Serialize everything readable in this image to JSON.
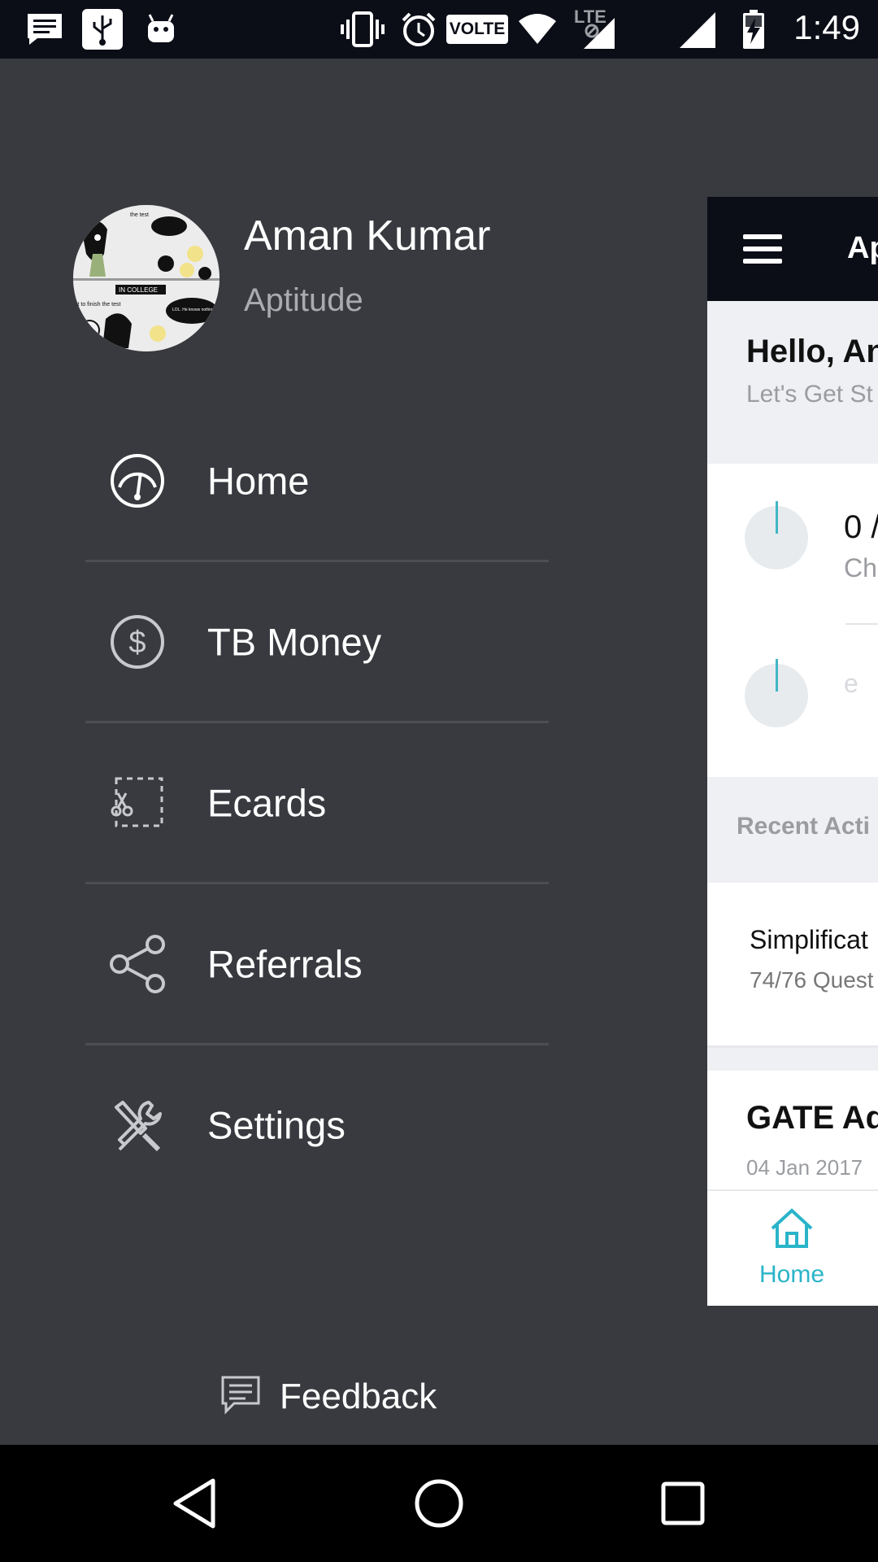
{
  "status_bar": {
    "time": "1:49",
    "icons": [
      "message-icon",
      "usb-icon",
      "android-icon",
      "vibrate-icon",
      "alarm-icon",
      "volte-icon",
      "wifi-icon",
      "lte-icon",
      "signal-icon",
      "signal-icon",
      "battery-charging-icon"
    ],
    "volte_label": "VOLTE",
    "lte_label": "LTE"
  },
  "drawer": {
    "user": {
      "name": "Aman Kumar",
      "subtitle": "Aptitude"
    },
    "avatar_text": {
      "top": "the test",
      "middle": "IN COLLEGE",
      "bottom_left": "st to finish the test",
      "bottom_right": "LOL. He knows nothing"
    },
    "menu_items": [
      {
        "label": "Home",
        "icon": "speedometer-icon"
      },
      {
        "label": "TB Money",
        "icon": "dollar-icon"
      },
      {
        "label": "Ecards",
        "icon": "scissors-icon"
      },
      {
        "label": "Referrals",
        "icon": "share-icon"
      },
      {
        "label": "Settings",
        "icon": "tools-icon"
      }
    ],
    "feedback": {
      "label": "Feedback",
      "icon": "feedback-icon"
    }
  },
  "main_peek": {
    "header_title": "Ap",
    "greeting": "Hello, An",
    "greeting_sub": "Let's Get St",
    "stat1_value": "0 /",
    "stat1_sub": "Ch",
    "stat2_value": "e",
    "recent_label": "Recent Acti",
    "activity_title": "Simplificat",
    "activity_sub": "74/76 Quest",
    "gate_title": "GATE Ad",
    "gate_date": "04 Jan 2017",
    "bottom_nav_home": "Home"
  },
  "colors": {
    "drawer_bg": "#383a3f",
    "status_bg": "#0b0d17",
    "accent": "#2ab4c9"
  },
  "nav_bar": {
    "buttons": [
      "back-icon",
      "home-circle-icon",
      "recents-icon"
    ]
  }
}
